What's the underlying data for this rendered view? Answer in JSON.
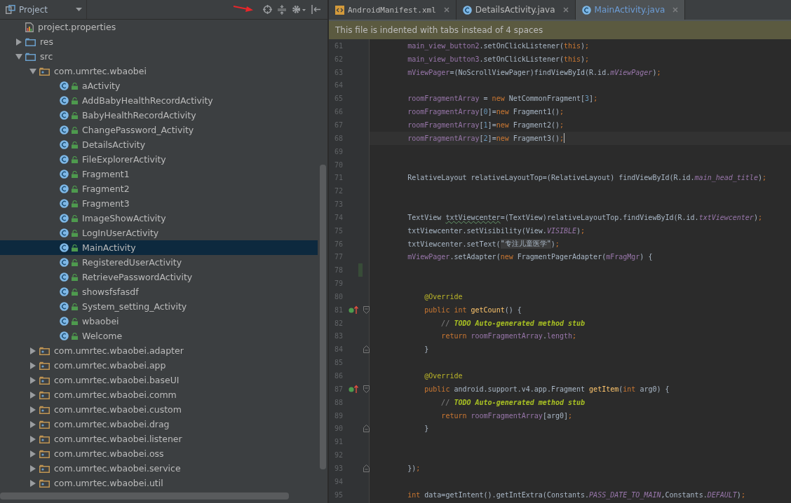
{
  "project_panel": {
    "title": "Project",
    "items": [
      {
        "name": "project.properties",
        "kind": "properties",
        "selected": false
      },
      {
        "name": "res",
        "kind": "folder",
        "expanded": false,
        "selected": false
      },
      {
        "name": "src",
        "kind": "folder",
        "expanded": true,
        "selected": false,
        "children": [
          {
            "name": "com.umrtec.wbaobei",
            "kind": "package",
            "expanded": true,
            "selected": false,
            "children": [
              {
                "name": "aActivity",
                "kind": "class",
                "selected": false
              },
              {
                "name": "AddBabyHealthRecordActivity",
                "kind": "class",
                "selected": false
              },
              {
                "name": "BabyHealthRecordActivity",
                "kind": "class",
                "selected": false
              },
              {
                "name": "ChangePassword_Activity",
                "kind": "class",
                "selected": false
              },
              {
                "name": "DetailsActivity",
                "kind": "class",
                "selected": false
              },
              {
                "name": "FileExplorerActivity",
                "kind": "class",
                "selected": false
              },
              {
                "name": "Fragment1",
                "kind": "class",
                "selected": false
              },
              {
                "name": "Fragment2",
                "kind": "class",
                "selected": false
              },
              {
                "name": "Fragment3",
                "kind": "class",
                "selected": false
              },
              {
                "name": "ImageShowActivity",
                "kind": "class",
                "selected": false
              },
              {
                "name": "LogInUserActivity",
                "kind": "class",
                "selected": false
              },
              {
                "name": "MainActivity",
                "kind": "class",
                "selected": true
              },
              {
                "name": "RegisteredUserActivity",
                "kind": "class",
                "selected": false
              },
              {
                "name": "RetrievePasswordActivity",
                "kind": "class",
                "selected": false
              },
              {
                "name": "showsfsfasdf",
                "kind": "class",
                "selected": false
              },
              {
                "name": "System_setting_Activity",
                "kind": "class",
                "selected": false
              },
              {
                "name": "wbaobei",
                "kind": "class",
                "selected": false
              },
              {
                "name": "Welcome",
                "kind": "class",
                "selected": false
              }
            ]
          },
          {
            "name": "com.umrtec.wbaobei.adapter",
            "kind": "package",
            "expanded": false,
            "selected": false
          },
          {
            "name": "com.umrtec.wbaobei.app",
            "kind": "package",
            "expanded": false,
            "selected": false
          },
          {
            "name": "com.umrtec.wbaobei.baseUI",
            "kind": "package",
            "expanded": false,
            "selected": false
          },
          {
            "name": "com.umrtec.wbaobei.comm",
            "kind": "package",
            "expanded": false,
            "selected": false
          },
          {
            "name": "com.umrtec.wbaobei.custom",
            "kind": "package",
            "expanded": false,
            "selected": false
          },
          {
            "name": "com.umrtec.wbaobei.drag",
            "kind": "package",
            "expanded": false,
            "selected": false
          },
          {
            "name": "com.umrtec.wbaobei.listener",
            "kind": "package",
            "expanded": false,
            "selected": false
          },
          {
            "name": "com.umrtec.wbaobei.oss",
            "kind": "package",
            "expanded": false,
            "selected": false
          },
          {
            "name": "com.umrtec.wbaobei.service",
            "kind": "package",
            "expanded": false,
            "selected": false
          },
          {
            "name": "com.umrtec.wbaobei.util",
            "kind": "package",
            "expanded": false,
            "selected": false
          }
        ]
      }
    ]
  },
  "editor": {
    "tabs": [
      {
        "label": "AndroidManifest.xml",
        "kind": "xml",
        "selected": false
      },
      {
        "label": "DetailsActivity.java",
        "kind": "class",
        "selected": false
      },
      {
        "label": "MainActivity.java",
        "kind": "class",
        "selected": true
      }
    ],
    "notice": "This file is indented with tabs instead of 4 spaces",
    "lines": [
      {
        "number": "61",
        "tokens": [
          {
            "kind": "field",
            "text": "         main_view_button2"
          },
          {
            "kind": "plain",
            "text": ".setOnClickListener("
          },
          {
            "kind": "keyword",
            "text": "this"
          },
          {
            "kind": "plain",
            "text": ")"
          },
          {
            "kind": "keyword",
            "text": ";"
          }
        ]
      },
      {
        "number": "62",
        "tokens": [
          {
            "kind": "field",
            "text": "         main_view_button3"
          },
          {
            "kind": "plain",
            "text": ".setOnClickListener("
          },
          {
            "kind": "keyword",
            "text": "this"
          },
          {
            "kind": "plain",
            "text": ")"
          },
          {
            "kind": "keyword",
            "text": ";"
          }
        ]
      },
      {
        "number": "63",
        "tokens": [
          {
            "kind": "field",
            "text": "         mViewPager"
          },
          {
            "kind": "plain",
            "text": "=(NoScrollViewPager)findViewById(R.id."
          },
          {
            "kind": "static",
            "text": "mViewPager"
          },
          {
            "kind": "plain",
            "text": ")"
          },
          {
            "kind": "keyword",
            "text": ";"
          }
        ]
      },
      {
        "number": "64"
      },
      {
        "number": "65",
        "tokens": [
          {
            "kind": "field",
            "text": "         roomFragmentArray"
          },
          {
            "kind": "plain",
            "text": " = "
          },
          {
            "kind": "keyword",
            "text": "new"
          },
          {
            "kind": "plain",
            "text": " NetCommonFragment["
          },
          {
            "kind": "number",
            "text": "3"
          },
          {
            "kind": "plain",
            "text": "]"
          },
          {
            "kind": "keyword",
            "text": ";"
          }
        ]
      },
      {
        "number": "66",
        "tokens": [
          {
            "kind": "field",
            "text": "         roomFragmentArray"
          },
          {
            "kind": "plain",
            "text": "["
          },
          {
            "kind": "number",
            "text": "0"
          },
          {
            "kind": "plain",
            "text": "]="
          },
          {
            "kind": "keyword",
            "text": "new"
          },
          {
            "kind": "plain",
            "text": " Fragment1()"
          },
          {
            "kind": "keyword",
            "text": ";"
          }
        ]
      },
      {
        "number": "67",
        "tokens": [
          {
            "kind": "field",
            "text": "         roomFragmentArray"
          },
          {
            "kind": "plain",
            "text": "["
          },
          {
            "kind": "number",
            "text": "1"
          },
          {
            "kind": "plain",
            "text": "]="
          },
          {
            "kind": "keyword",
            "text": "new"
          },
          {
            "kind": "plain",
            "text": " Fragment2()"
          },
          {
            "kind": "keyword",
            "text": ";"
          }
        ]
      },
      {
        "number": "68",
        "current": true,
        "tokens": [
          {
            "kind": "field",
            "text": "         roomFragmentArray"
          },
          {
            "kind": "plain",
            "text": "["
          },
          {
            "kind": "number",
            "text": "2"
          },
          {
            "kind": "plain",
            "text": "]="
          },
          {
            "kind": "keyword",
            "text": "new"
          },
          {
            "kind": "plain",
            "text": " Fragment3()"
          },
          {
            "kind": "keyword",
            "text": ";"
          }
        ]
      },
      {
        "number": "69"
      },
      {
        "number": "70"
      },
      {
        "number": "71",
        "tokens": [
          {
            "kind": "plain",
            "text": "         RelativeLayout relativeLayoutTop=(RelativeLayout) findViewById(R.id."
          },
          {
            "kind": "static",
            "text": "main_head_title"
          },
          {
            "kind": "plain",
            "text": ")"
          },
          {
            "kind": "keyword",
            "text": ";"
          }
        ]
      },
      {
        "number": "72"
      },
      {
        "number": "73"
      },
      {
        "number": "74",
        "tokens": [
          {
            "kind": "plain",
            "text": "         TextView "
          },
          {
            "kind": "typo",
            "text": "txtViewcenter"
          },
          {
            "kind": "plain",
            "text": "=(TextView)relativeLayoutTop.findViewById(R.id."
          },
          {
            "kind": "static",
            "text": "txtViewcenter"
          },
          {
            "kind": "plain",
            "text": ")"
          },
          {
            "kind": "keyword",
            "text": ";"
          }
        ]
      },
      {
        "number": "75",
        "tokens": [
          {
            "kind": "plain",
            "text": "         txtViewcenter.setVisibility(View."
          },
          {
            "kind": "static",
            "text": "VISIBLE"
          },
          {
            "kind": "plain",
            "text": ")"
          },
          {
            "kind": "keyword",
            "text": ";"
          }
        ]
      },
      {
        "number": "76",
        "tokens": [
          {
            "kind": "plain",
            "text": "         txtViewcenter.setText("
          },
          {
            "kind": "string",
            "text": "\"专注儿童医学\""
          },
          {
            "kind": "plain",
            "text": ")"
          },
          {
            "kind": "keyword",
            "text": ";"
          }
        ]
      },
      {
        "number": "77",
        "tokens": [
          {
            "kind": "field",
            "text": "         mViewPager"
          },
          {
            "kind": "plain",
            "text": ".setAdapter("
          },
          {
            "kind": "keyword",
            "text": "new"
          },
          {
            "kind": "plain",
            "text": " FragmentPagerAdapter("
          },
          {
            "kind": "field",
            "text": "mFragMgr"
          },
          {
            "kind": "plain",
            "text": ") {"
          }
        ]
      },
      {
        "number": "78",
        "changed": true
      },
      {
        "number": "79"
      },
      {
        "number": "80",
        "tokens": [
          {
            "kind": "annotation",
            "text": "             @Override"
          }
        ]
      },
      {
        "number": "81",
        "override": true,
        "fold_start": true,
        "tokens": [
          {
            "kind": "keyword",
            "text": "             public int "
          },
          {
            "kind": "method",
            "text": "getCount"
          },
          {
            "kind": "plain",
            "text": "() {"
          }
        ]
      },
      {
        "number": "82",
        "tokens": [
          {
            "kind": "comment",
            "text": "                 // "
          },
          {
            "kind": "todo",
            "text": "TODO Auto-generated method stub"
          }
        ]
      },
      {
        "number": "83",
        "tokens": [
          {
            "kind": "keyword",
            "text": "                 return "
          },
          {
            "kind": "field",
            "text": "roomFragmentArray"
          },
          {
            "kind": "plain",
            "text": "."
          },
          {
            "kind": "field",
            "text": "length"
          },
          {
            "kind": "keyword",
            "text": ";"
          }
        ]
      },
      {
        "number": "84",
        "fold_end": true,
        "tokens": [
          {
            "kind": "plain",
            "text": "             }"
          }
        ]
      },
      {
        "number": "85"
      },
      {
        "number": "86",
        "tokens": [
          {
            "kind": "annotation",
            "text": "             @Override"
          }
        ]
      },
      {
        "number": "87",
        "override": true,
        "fold_start": true,
        "tokens": [
          {
            "kind": "keyword",
            "text": "             public "
          },
          {
            "kind": "plain",
            "text": "android.support.v4.app.Fragment "
          },
          {
            "kind": "method",
            "text": "getItem"
          },
          {
            "kind": "plain",
            "text": "("
          },
          {
            "kind": "keyword",
            "text": "int "
          },
          {
            "kind": "plain",
            "text": "arg0) {"
          }
        ]
      },
      {
        "number": "88",
        "tokens": [
          {
            "kind": "comment",
            "text": "                 // "
          },
          {
            "kind": "todo",
            "text": "TODO Auto-generated method stub"
          }
        ]
      },
      {
        "number": "89",
        "tokens": [
          {
            "kind": "keyword",
            "text": "                 return "
          },
          {
            "kind": "field",
            "text": "roomFragmentArray"
          },
          {
            "kind": "plain",
            "text": "[arg0]"
          },
          {
            "kind": "keyword",
            "text": ";"
          }
        ]
      },
      {
        "number": "90",
        "fold_end": true,
        "tokens": [
          {
            "kind": "plain",
            "text": "             }"
          }
        ]
      },
      {
        "number": "91"
      },
      {
        "number": "92"
      },
      {
        "number": "93",
        "fold_end": true,
        "tokens": [
          {
            "kind": "plain",
            "text": "         })"
          },
          {
            "kind": "keyword",
            "text": ";"
          }
        ]
      },
      {
        "number": "94"
      },
      {
        "number": "95",
        "tokens": [
          {
            "kind": "keyword",
            "text": "         int "
          },
          {
            "kind": "plain",
            "text": "data=getIntent().getIntExtra(Constants."
          },
          {
            "kind": "static",
            "text": "PASS_DATE_TO_MAIN"
          },
          {
            "kind": "plain",
            "text": ",Constants."
          },
          {
            "kind": "static",
            "text": "DEFAULT"
          },
          {
            "kind": "plain",
            "text": ")"
          },
          {
            "kind": "keyword",
            "text": ";"
          }
        ]
      }
    ]
  }
}
